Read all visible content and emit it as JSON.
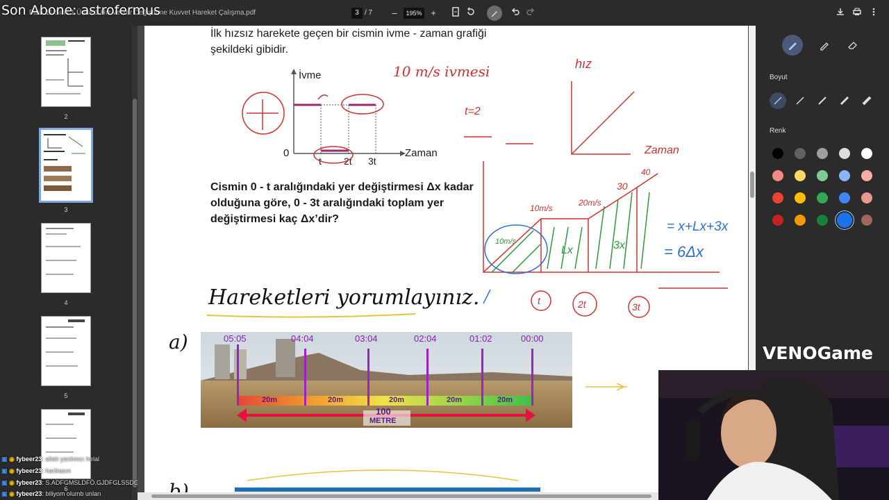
{
  "overlay": {
    "text": "Son Abone: astrofermus"
  },
  "toolbar": {
    "filename": "Fizik 11 Sınıf 1 Ünite 1 Hız ve Yer Değiştirme Kuvvet Hareket Çalışma.pdf",
    "current_page": "3",
    "total_pages": "/ 7",
    "zoom": "195%",
    "zoom_out": "–",
    "zoom_in": "+"
  },
  "thumbnails": [
    {
      "num": "2"
    },
    {
      "num": "3"
    },
    {
      "num": "4"
    },
    {
      "num": "5"
    },
    {
      "num": "6"
    }
  ],
  "chat": [
    {
      "user": "fybeer23",
      "msg": ": allah yardımcı helal"
    },
    {
      "user": "fybeer23",
      "msg": ": harikasın"
    },
    {
      "user": "fybeer23",
      "msg": ": S.ADFGMSLDFÖ.GJDFGLSSDGS"
    },
    {
      "user": "fybeer23",
      "msg": ": biliyom olumb unları"
    }
  ],
  "question": {
    "intro": "İlk hızsız harekete geçen bir cismin ivme - zaman grafiği şekildeki gibidir.",
    "body": "Cismin 0 - t aralığındaki yer değiştirmesi Δx kadar olduğuna göre, 0 - 3t aralığındaki toplam yer değiştirmesi kaç Δx’dir?",
    "y_axis": "İvme",
    "x_axis": "Zaman",
    "origin": "0",
    "ticks": [
      "t",
      "2t",
      "3t"
    ]
  },
  "handwriting": {
    "top_note": "10 m/s ivmesi",
    "hiz": "hız",
    "zaman": "Zaman",
    "t2": "t=2",
    "v1": "10m/s",
    "v2": "20m/s",
    "v3": "30",
    "v4": "40",
    "eq1": "= x+Lx+3x",
    "eq2": "= 6Δx",
    "areas": [
      "10m/s",
      "Lx",
      "3x"
    ],
    "circled": [
      "t",
      "2t",
      "3t"
    ],
    "heading": "Hareketleri yorumlayınız.",
    "part_a": "a)",
    "part_b": "b)"
  },
  "timeline": {
    "times": [
      "05:05",
      "04:04",
      "03:04",
      "02:04",
      "01:02",
      "00:00"
    ],
    "segments": [
      "20m",
      "20m",
      "20m",
      "20m",
      "20m"
    ],
    "total": "100",
    "unit": "METRE"
  },
  "right_panel": {
    "size_label": "Boyut",
    "color_label": "Renk",
    "colors": [
      "#000000",
      "#5f6368",
      "#9aa0a6",
      "#dadce0",
      "#ffffff",
      "#f28b82",
      "#fdd663",
      "#81c995",
      "#8ab4f8",
      "#f6aea9",
      "#ea4335",
      "#fbbc04",
      "#34a853",
      "#4285f4",
      "#e8998d",
      "#c5221f",
      "#f29900",
      "#188038",
      "#1a73e8",
      "#a0655f"
    ]
  },
  "brand": {
    "logo": "VENO",
    "logo_sub": "Game"
  }
}
